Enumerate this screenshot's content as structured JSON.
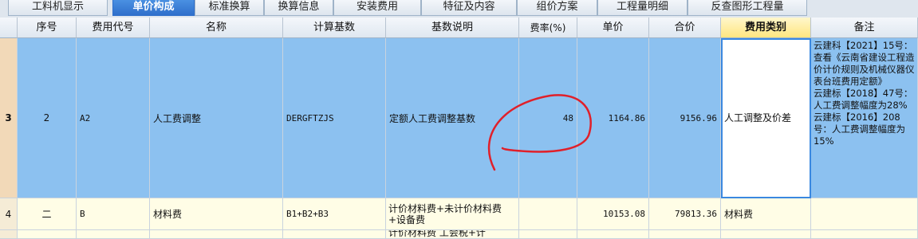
{
  "tabs": [
    {
      "label": "工料机显示",
      "active": false
    },
    {
      "label": "单价构成",
      "active": true
    },
    {
      "label": "标准换算",
      "active": false
    },
    {
      "label": "换算信息",
      "active": false
    },
    {
      "label": "安装费用",
      "active": false
    },
    {
      "label": "特征及内容",
      "active": false
    },
    {
      "label": "组价方案",
      "active": false
    },
    {
      "label": "工程量明细",
      "active": false
    },
    {
      "label": "反查图形工程量",
      "active": false
    }
  ],
  "columns": {
    "seq": "序号",
    "code": "费用代号",
    "name": "名称",
    "base": "计算基数",
    "base_desc": "基数说明",
    "rate": "费率(%)",
    "unit_price": "单价",
    "total": "合价",
    "fee_type": "费用类别",
    "remark": "备注"
  },
  "rows": [
    {
      "row_no": "3",
      "seq": "2",
      "code": "A2",
      "name": "人工费调整",
      "base": "DERGFTZJS",
      "base_desc": "定额人工费调整基数",
      "rate": "48",
      "unit_price": "1164.86",
      "total": "9156.96",
      "fee_type": "人工调整及价差",
      "remark": "云建科【2021】15号：查看《云南省建设工程造价计价规则及机械仪器仪表台班费用定额》\n云建标【2018】47号：人工费调整幅度为28%\n云建标【2016】208号：人工费调整幅度为15%"
    },
    {
      "row_no": "4",
      "seq": "二",
      "code": "B",
      "name": "材料费",
      "base": "B1+B2+B3",
      "base_desc": "计价材料费+未计价材料费+设备费",
      "rate": "",
      "unit_price": "10153.08",
      "total": "79813.36",
      "fee_type": "材料费",
      "remark": ""
    },
    {
      "row_no": "",
      "seq": "",
      "code": "",
      "name": "",
      "base": "",
      "base_desc": "计价材料费 工会税+计",
      "rate": "",
      "unit_price": "",
      "total": "",
      "fee_type": "",
      "remark": ""
    }
  ],
  "colors": {
    "selected_row": "#8cc1f0",
    "normal_row": "#fffde6",
    "active_tab": "#2f6fcb",
    "annotation": "#e0202a"
  }
}
